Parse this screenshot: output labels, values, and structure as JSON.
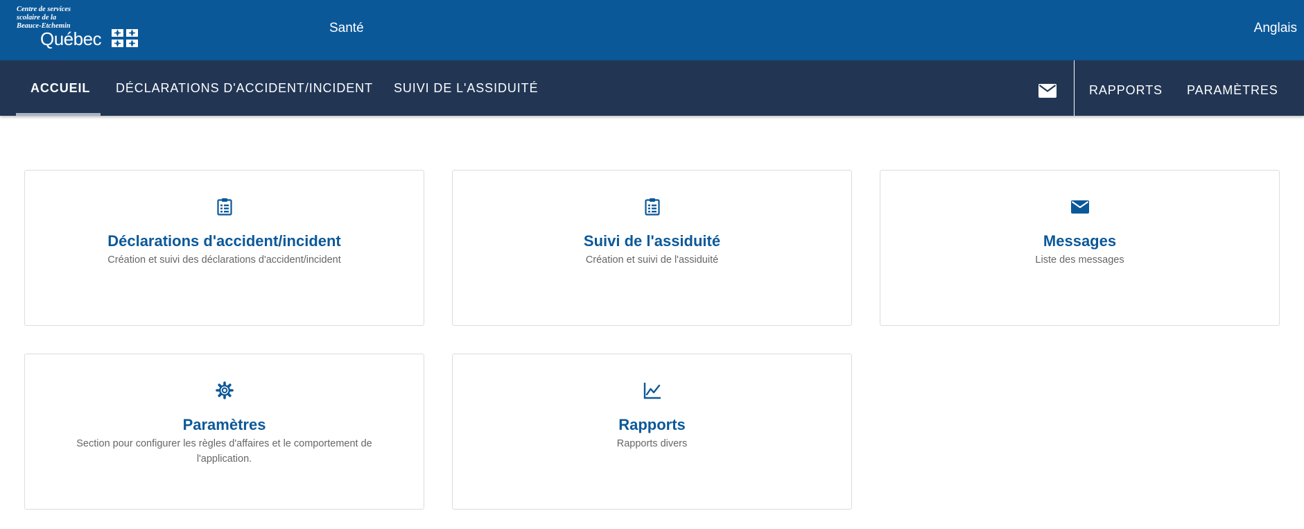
{
  "brand": {
    "org_line1": "Centre de services",
    "org_line2": "scolaire de la",
    "org_line3": "Beauce-Etchemin",
    "logo_word": "Québec"
  },
  "header": {
    "app_title": "Santé",
    "language_link": "Anglais"
  },
  "nav": {
    "tabs": [
      {
        "label": "Accueil",
        "active": true
      },
      {
        "label": "Déclarations d'accident/incident",
        "active": false
      },
      {
        "label": "Suivi de l'assiduité",
        "active": false
      }
    ],
    "mail_icon": "mail-icon",
    "right_items": [
      {
        "label": "Rapports"
      },
      {
        "label": "Paramètres"
      }
    ]
  },
  "cards": [
    {
      "icon": "clipboard-list-icon",
      "title": "Déclarations d'accident/incident",
      "description": "Création et suivi des déclarations d'accident/incident"
    },
    {
      "icon": "clipboard-list-icon",
      "title": "Suivi de l'assiduité",
      "description": "Création et suivi de l'assiduité"
    },
    {
      "icon": "mail-icon",
      "title": "Messages",
      "description": "Liste des messages"
    },
    {
      "icon": "gear-icon",
      "title": "Paramètres",
      "description": "Section pour configurer les règles d'affaires et le comportement de l'application."
    },
    {
      "icon": "line-chart-icon",
      "title": "Rapports",
      "description": "Rapports divers"
    }
  ],
  "colors": {
    "header_blue": "#0b5899",
    "nav_dark": "#223654",
    "card_title": "#0b5899"
  }
}
